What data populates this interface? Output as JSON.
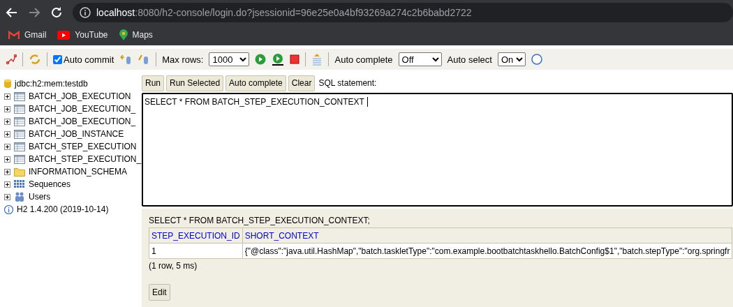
{
  "browser": {
    "url_host": "localhost",
    "url_path": ":8080/h2-console/login.do?jsessionid=96e25e0a4bf93269a274c2b6babd2722",
    "bookmarks": [
      {
        "label": "Gmail",
        "kind": "gmail"
      },
      {
        "label": "YouTube",
        "kind": "youtube"
      },
      {
        "label": "Maps",
        "kind": "maps"
      }
    ]
  },
  "toolbar": {
    "auto_commit": {
      "label": "Auto commit",
      "checked": true
    },
    "max_rows": {
      "label": "Max rows:",
      "value": "1000"
    },
    "auto_complete": {
      "label": "Auto complete",
      "value": "Off"
    },
    "auto_select": {
      "label": "Auto select",
      "value": "On"
    }
  },
  "tree": {
    "connection": "jdbc:h2:mem:testdb",
    "items": [
      {
        "label": "BATCH_JOB_EXECUTION",
        "kind": "table",
        "expanded": false
      },
      {
        "label": "BATCH_JOB_EXECUTION_",
        "kind": "table",
        "expanded": false
      },
      {
        "label": "BATCH_JOB_EXECUTION_",
        "kind": "table",
        "expanded": false
      },
      {
        "label": "BATCH_JOB_INSTANCE",
        "kind": "table",
        "expanded": false
      },
      {
        "label": "BATCH_STEP_EXECUTION",
        "kind": "table",
        "expanded": false
      },
      {
        "label": "BATCH_STEP_EXECUTION_",
        "kind": "table",
        "expanded": false
      },
      {
        "label": "INFORMATION_SCHEMA",
        "kind": "folder",
        "expanded": false
      },
      {
        "label": "Sequences",
        "kind": "sequences",
        "expanded": false
      },
      {
        "label": "Users",
        "kind": "users",
        "expanded": false
      }
    ],
    "version": "H2 1.4.200 (2019-10-14)"
  },
  "editor": {
    "buttons": [
      "Run",
      "Run Selected",
      "Auto complete",
      "Clear"
    ],
    "label": "SQL statement:",
    "value": "SELECT * FROM BATCH_STEP_EXECUTION_CONTEXT"
  },
  "result": {
    "query": "SELECT * FROM BATCH_STEP_EXECUTION_CONTEXT;",
    "columns": [
      "STEP_EXECUTION_ID",
      "SHORT_CONTEXT"
    ],
    "rows": [
      [
        "1",
        "{\"@class\":\"java.util.HashMap\",\"batch.taskletType\":\"com.example.bootbatchtaskhello.BatchConfig$1\",\"batch.stepType\":\"org.springfr"
      ]
    ],
    "summary": "(1 row, 5 ms)",
    "buttons": [
      "Edit"
    ]
  }
}
